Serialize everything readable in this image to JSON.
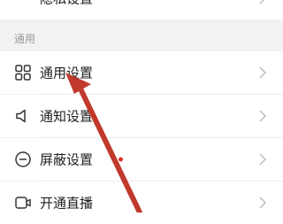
{
  "top_item": {
    "label": "隐私设置"
  },
  "section": {
    "title": "通用"
  },
  "items": [
    {
      "label": "通用设置",
      "icon": "grid-icon"
    },
    {
      "label": "通知设置",
      "icon": "speaker-icon"
    },
    {
      "label": "屏蔽设置",
      "icon": "block-icon",
      "has_dot": true
    },
    {
      "label": "开通直播",
      "icon": "live-icon"
    }
  ],
  "colors": {
    "arrow": "#c0392b",
    "dot": "#e0302f",
    "background": "#f2f2f2"
  }
}
